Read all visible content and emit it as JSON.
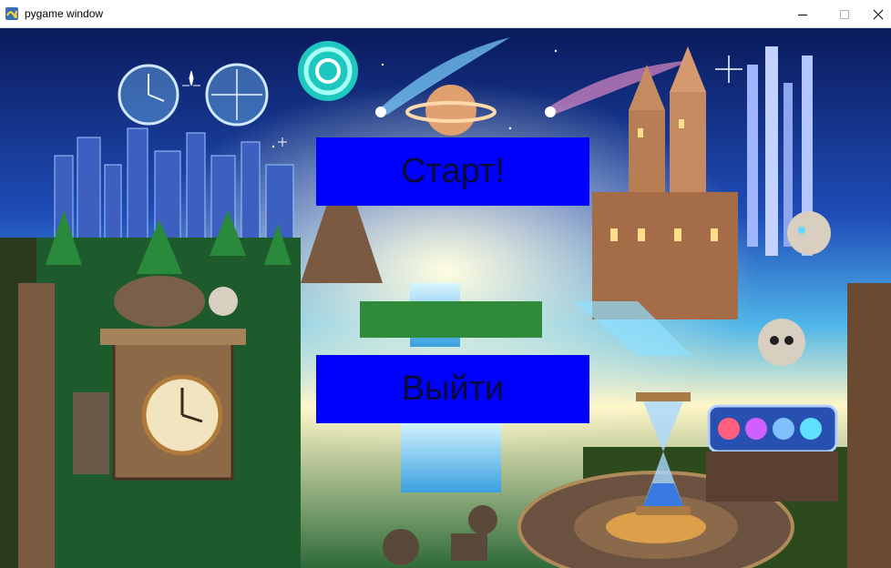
{
  "window": {
    "title": "pygame window",
    "icons": {
      "app": "pygame-snake-icon",
      "minimize": "minimize-icon",
      "maximize": "maximize-icon",
      "close": "close-icon"
    }
  },
  "menu": {
    "start_label": "Старт!",
    "quit_label": "Выйти",
    "button_color": "#0000ff",
    "text_color": "#0a0a3a"
  },
  "background": {
    "description_kind": "pixel-art fantasy scene",
    "elements": [
      "clock-icon",
      "spiral-portal",
      "comet",
      "ringed-planet",
      "city-skyline",
      "gothic-castle",
      "waterfall",
      "stone-clock-shrine",
      "skull",
      "hourglass",
      "crystal-orbs-case"
    ]
  }
}
